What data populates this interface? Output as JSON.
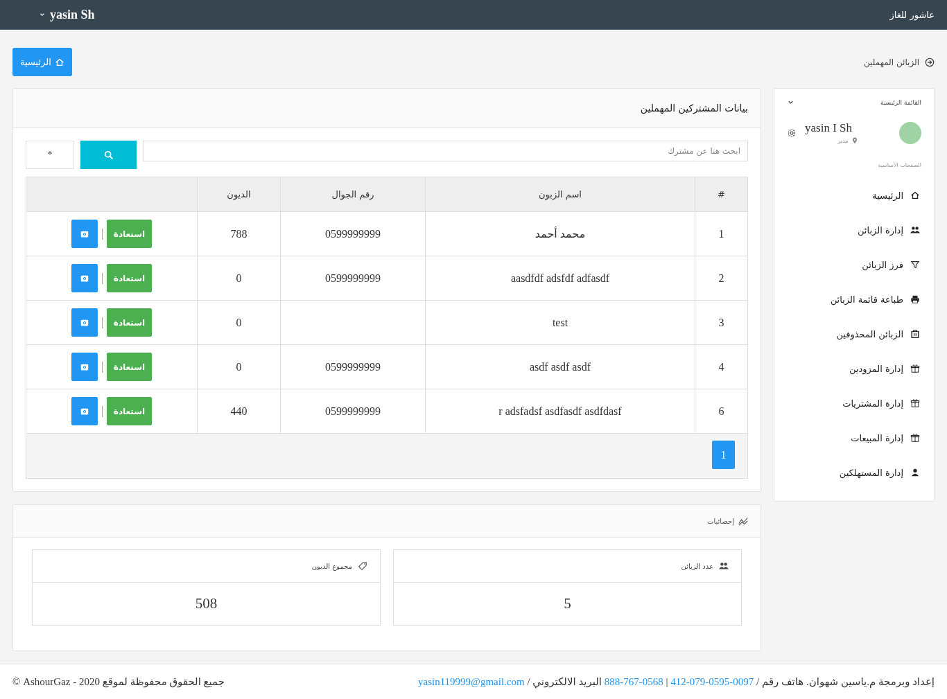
{
  "topbar": {
    "brand": "عاشور للغاز",
    "user": "yasin Sh"
  },
  "breadcrumb": {
    "title": "الزبائن المهملين",
    "home_button": "الرئيسية"
  },
  "panel": {
    "title": "بيانات المشتركين المهملين",
    "search": {
      "placeholder": "ابحث هنا عن مشترك"
    },
    "all_button": "*",
    "table": {
      "columns": [
        "#",
        "اسم الزبون",
        "رقم الجوال",
        "الديون"
      ],
      "rows": [
        {
          "num": "1",
          "name": "محمد أحمد",
          "phone": "0599999999",
          "debt": "788",
          "action": "استعادة"
        },
        {
          "num": "2",
          "name": "aasdfdf adsfdf adfasdf",
          "phone": "0599999999",
          "debt": "0",
          "action": "استعادة"
        },
        {
          "num": "3",
          "name": "test",
          "debt": "0",
          "action": "استعادة"
        },
        {
          "num": "4",
          "name": "asdf asdf asdf",
          "phone": "0599999999",
          "debt": "0",
          "action": "استعادة"
        },
        {
          "num": "6",
          "name": "r adsfadsf asdfasdf asdfdasf",
          "phone": "0599999999",
          "debt": "440",
          "action": "استعادة"
        }
      ]
    },
    "pages": [
      {
        "label": "1",
        "selected": true
      }
    ]
  },
  "stats": {
    "title": "إحصائيات",
    "cards": [
      {
        "label": "عدد الزبائن",
        "value": "5"
      },
      {
        "label": "مجموع الديون",
        "value": "508"
      }
    ]
  },
  "sidebar": {
    "title": "القائمة الرئيسية",
    "user": {
      "name": "yasin I Sh",
      "role": "مدير"
    },
    "section": "الصفحات الأساسية",
    "items": [
      {
        "label": "الرئيسية"
      },
      {
        "label": "إدارة الزبائن"
      },
      {
        "label": "فرز الزبائن"
      },
      {
        "label": "طباعة قائمة الزبائن"
      },
      {
        "label": "الزبائن المحذوفين"
      },
      {
        "label": "إدارة المزودين"
      },
      {
        "label": "إدارة المشتريات"
      },
      {
        "label": "إدارة المبيعات"
      },
      {
        "label": "إدارة المستهلكين"
      }
    ]
  },
  "footer": {
    "credit": "إعداد وبرمجة م.ياسين شهوان. هاتف رقم /",
    "phone_1": "0097-0595-079-412",
    "separator": "|",
    "phone_2": "0568-767-888",
    "email_label": "البريد الالكتروني /",
    "email": "yasin119999@gmail.com",
    "copyright": "جميع الحقوق محفوظة لموقع 2020 - AshourGaz ©"
  }
}
